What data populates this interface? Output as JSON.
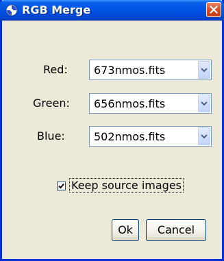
{
  "window": {
    "title": "RGB Merge",
    "app_icon": "imagej-icon",
    "close_icon": "close-icon"
  },
  "fields": [
    {
      "label": "Red:",
      "value": "673nmos.fits"
    },
    {
      "label": "Green:",
      "value": "656nmos.fits"
    },
    {
      "label": "Blue:",
      "value": "502nmos.fits"
    }
  ],
  "keep_source": {
    "label": "Keep source images",
    "checked": true
  },
  "buttons": {
    "ok": "Ok",
    "cancel": "Cancel"
  }
}
